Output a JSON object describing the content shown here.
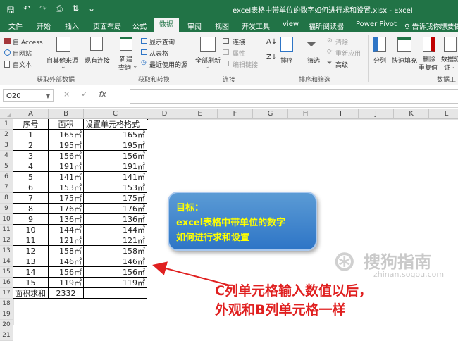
{
  "window": {
    "title": "excel表格中带单位的数字如何进行求和设置.xlsx  -  Excel",
    "qat": [
      "save-icon",
      "undo-icon",
      "redo-icon",
      "print-preview-icon",
      "sort-icon",
      "more-icon"
    ]
  },
  "tabs": [
    "文件",
    "开始",
    "插入",
    "页面布局",
    "公式",
    "数据",
    "审阅",
    "视图",
    "开发工具",
    "view",
    "福昕阅读器",
    "Power Pivot",
    "♀ 告诉我你想要做"
  ],
  "active_tab": "数据",
  "ribbon": {
    "get_external": {
      "access": "自 Access",
      "web": "自网站",
      "text": "自文本",
      "other": "自其他来源",
      "existing": "现有连接",
      "label": "获取外部数据"
    },
    "transform": {
      "new_query_1": "新建",
      "new_query_2": "查询",
      "show_queries": "显示查询",
      "from_table": "从表格",
      "recent_sources": "最近使用的源",
      "label": "获取和转换"
    },
    "connections": {
      "refresh_1": "全部刷新",
      "connections": "连接",
      "properties": "属性",
      "edit_links": "编辑链接",
      "label": "连接"
    },
    "sort_filter": {
      "sort": "排序",
      "filter": "筛选",
      "clear": "清除",
      "reapply": "重新应用",
      "advanced": "高级",
      "label": "排序和筛选"
    },
    "data_tools": {
      "split": "分列",
      "flash_fill": "快速填充",
      "remove_dup_1": "删除",
      "remove_dup_2": "重复值",
      "validate_1": "数据验",
      "validate_2": "证 ·",
      "label": "数据工"
    }
  },
  "formula_bar": {
    "name_box": "O20",
    "cancel": "×",
    "enter": "✓",
    "fx": "fx",
    "content": ""
  },
  "columns": [
    "A",
    "B",
    "C",
    "D",
    "E",
    "F",
    "G",
    "H",
    "I",
    "J",
    "K",
    "L"
  ],
  "rows": [
    "1",
    "2",
    "3",
    "4",
    "5",
    "6",
    "7",
    "8",
    "9",
    "10",
    "11",
    "12",
    "13",
    "14",
    "15",
    "16",
    "17",
    "18",
    "19",
    "20",
    "21"
  ],
  "table": {
    "header": [
      "序号",
      "面积",
      "设置单元格格式"
    ],
    "rows": [
      [
        "1",
        "165㎡",
        "165㎡"
      ],
      [
        "2",
        "195㎡",
        "195㎡"
      ],
      [
        "3",
        "156㎡",
        "156㎡"
      ],
      [
        "4",
        "191㎡",
        "191㎡"
      ],
      [
        "5",
        "141㎡",
        "141㎡"
      ],
      [
        "6",
        "153㎡",
        "153㎡"
      ],
      [
        "7",
        "175㎡",
        "175㎡"
      ],
      [
        "8",
        "176㎡",
        "176㎡"
      ],
      [
        "9",
        "136㎡",
        "136㎡"
      ],
      [
        "10",
        "144㎡",
        "144㎡"
      ],
      [
        "11",
        "121㎡",
        "121㎡"
      ],
      [
        "12",
        "158㎡",
        "158㎡"
      ],
      [
        "13",
        "146㎡",
        "146㎡"
      ],
      [
        "14",
        "156㎡",
        "156㎡"
      ],
      [
        "15",
        "119㎡",
        "119㎡"
      ]
    ],
    "total_label": "面积求和",
    "total_value": "2332"
  },
  "callout": {
    "line1": "目标：",
    "line2": "excel表格中带单位的数字",
    "line3": "如何进行求和设置"
  },
  "annotation": {
    "line1": "C列单元格输入数值以后，",
    "line2": "外观和B列单元格一样"
  },
  "watermark": {
    "brand": "搜狗指南",
    "url": "zhinan.sogou.com"
  },
  "colors": {
    "excel_green": "#217346",
    "annotation_red": "#e02020",
    "callout_blue": "#2e75c6",
    "callout_text": "#ffff00"
  }
}
